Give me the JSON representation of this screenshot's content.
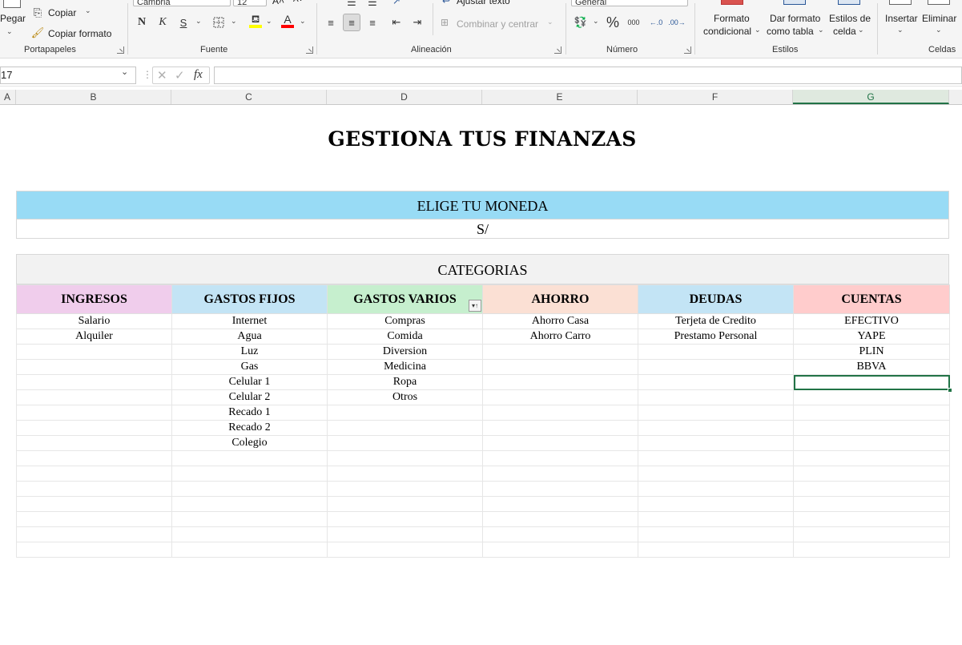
{
  "ribbon": {
    "clipboard": {
      "paste_label": "Pegar",
      "copy_label": "Copiar",
      "format_painter_label": "Copiar formato",
      "group_label": "Portapapeles"
    },
    "font": {
      "font_name": "Cambria",
      "font_size": "12",
      "bold_label": "N",
      "italic_label": "K",
      "underline_label": "S",
      "font_color_label": "A",
      "group_label": "Fuente",
      "fill_color": "#ffff00",
      "text_color": "#ff0000"
    },
    "alignment": {
      "wrap_text_label": "Ajustar texto",
      "merge_center_label": "Combinar y centrar",
      "group_label": "Alineación"
    },
    "number": {
      "format_value": "General",
      "percent_label": "%",
      "thousands_label": "000",
      "group_label": "Número"
    },
    "styles": {
      "conditional_line1": "Formato",
      "conditional_line2": "condicional",
      "table_line1": "Dar formato",
      "table_line2": "como tabla",
      "cellstyles_line1": "Estilos de",
      "cellstyles_line2": "celda",
      "group_label": "Estilos"
    },
    "cells": {
      "insert_label": "Insertar",
      "delete_label": "Eliminar",
      "group_label": "Celdas"
    }
  },
  "formula_bar": {
    "name_box": "17",
    "fx_label": "fx",
    "formula": ""
  },
  "columns": [
    "A",
    "B",
    "C",
    "D",
    "E",
    "F",
    "G"
  ],
  "active_column": "G",
  "sheet": {
    "title": "GESTIONA TUS FINANZAS",
    "currency_header": "ELIGE TU MONEDA",
    "currency_value": "S/",
    "categories_header": "CATEGORIAS",
    "table": {
      "headers": [
        {
          "label": "INGRESOS",
          "color": "#f0cdec"
        },
        {
          "label": "GASTOS FIJOS",
          "color": "#c3e4f5"
        },
        {
          "label": "GASTOS VARIOS",
          "color": "#c6efce"
        },
        {
          "label": "AHORRO",
          "color": "#fbe0d4"
        },
        {
          "label": "DEUDAS",
          "color": "#c3e4f5"
        },
        {
          "label": "CUENTAS",
          "color": "#ffcccc"
        }
      ],
      "rows": [
        [
          "Salario",
          "Internet",
          "Compras",
          "Ahorro Casa",
          "Terjeta de Credito",
          "EFECTIVO"
        ],
        [
          "Alquiler",
          "Agua",
          "Comida",
          "Ahorro Carro",
          "Prestamo Personal",
          "YAPE"
        ],
        [
          "",
          "Luz",
          "Diversion",
          "",
          "",
          "PLIN"
        ],
        [
          "",
          "Gas",
          "Medicina",
          "",
          "",
          "BBVA"
        ],
        [
          "",
          "Celular 1",
          "Ropa",
          "",
          "",
          ""
        ],
        [
          "",
          "Celular 2",
          "Otros",
          "",
          "",
          ""
        ],
        [
          "",
          "Recado 1",
          "",
          "",
          "",
          ""
        ],
        [
          "",
          "Recado 2",
          "",
          "",
          "",
          ""
        ],
        [
          "",
          "Colegio",
          "",
          "",
          "",
          ""
        ],
        [
          "",
          "",
          "",
          "",
          "",
          ""
        ],
        [
          "",
          "",
          "",
          "",
          "",
          ""
        ],
        [
          "",
          "",
          "",
          "",
          "",
          ""
        ],
        [
          "",
          "",
          "",
          "",
          "",
          ""
        ],
        [
          "",
          "",
          "",
          "",
          "",
          ""
        ],
        [
          "",
          "",
          "",
          "",
          "",
          ""
        ],
        [
          "",
          "",
          "",
          "",
          "",
          ""
        ]
      ]
    }
  }
}
